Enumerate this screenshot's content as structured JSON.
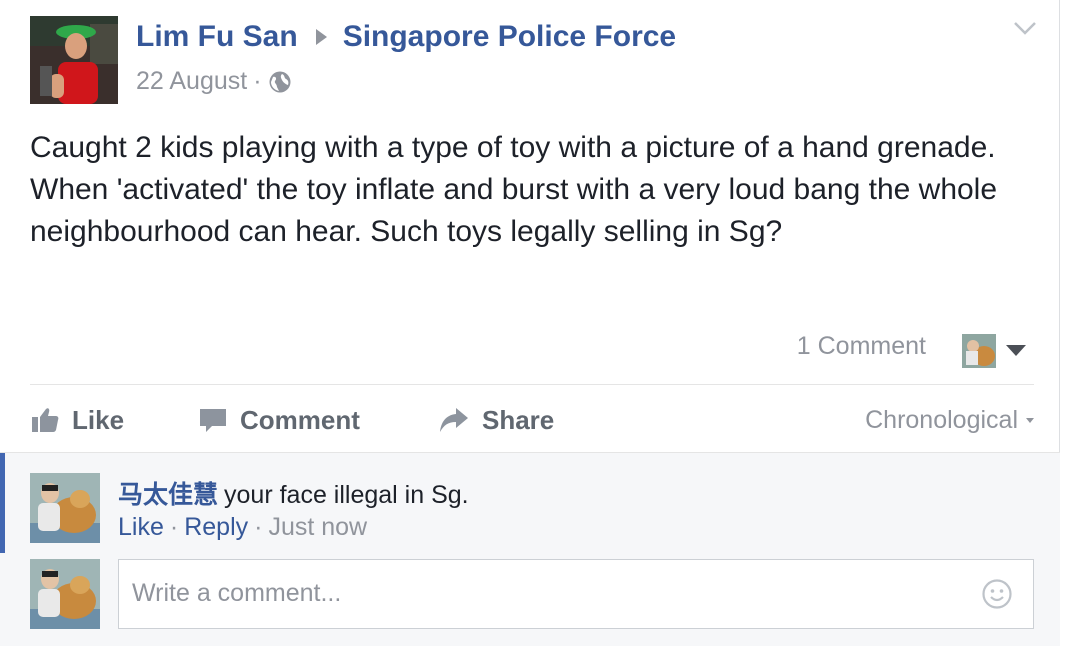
{
  "post": {
    "author": "Lim Fu San",
    "target": "Singapore Police Force",
    "date": "22 August",
    "dot": "·",
    "text": "Caught 2 kids playing with a type of toy with a picture of a hand grenade. When 'activated' the toy inflate and burst with a very loud bang the whole neighbourhood can hear. Such toys legally selling in Sg?",
    "comment_count": "1 Comment"
  },
  "actions": {
    "like": "Like",
    "comment": "Comment",
    "share": "Share",
    "sort": "Chronological"
  },
  "comment": {
    "author": "马太佳慧",
    "text": "your face illegal in Sg.",
    "like": "Like",
    "reply": "Reply",
    "time": "Just now",
    "sep": "·"
  },
  "composer": {
    "placeholder": "Write a comment..."
  },
  "icons": {
    "globe": "globe-icon",
    "chevron": "chevron-down-icon",
    "like": "thumbs-up-icon",
    "comment": "speech-bubble-icon",
    "share": "share-arrow-icon",
    "emoji": "smiley-icon"
  },
  "colors": {
    "link": "#365899",
    "muted": "#90949c",
    "action": "#606770",
    "accent": "#4267b2"
  }
}
